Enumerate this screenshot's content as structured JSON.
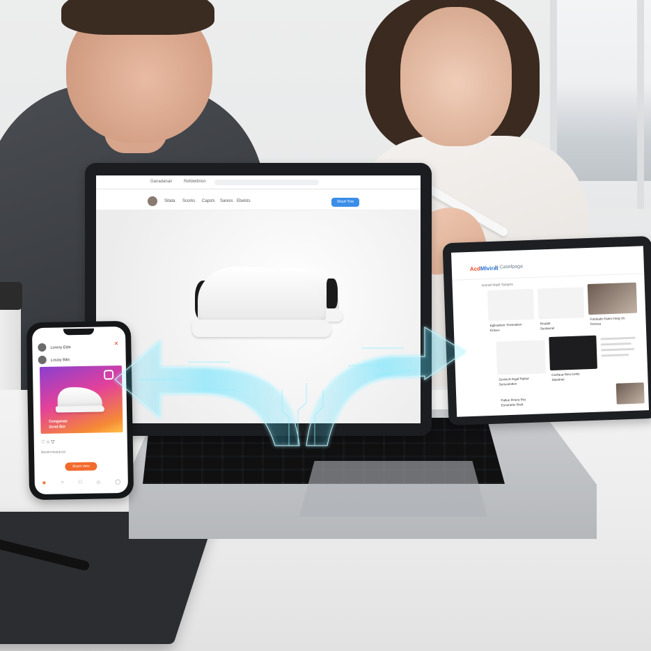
{
  "laptop": {
    "topbar_left": "Ganadanan",
    "topbar_mid": "Refdwtitrion",
    "nav_brand": "Sitata",
    "nav_items": [
      "Scorks",
      "Capsts",
      "Saress",
      "Ebelsts"
    ],
    "cta_label": "Shurt Yne"
  },
  "tablet": {
    "logo_part1": "Acd",
    "logo_part2": "Mlvirat",
    "logo_suffix": "",
    "subtitle": "K Caselpaga",
    "filter": "Arsntd Matlt  Taiopns",
    "cards": [
      {
        "caption": "Egiloartenr Tsrarvation",
        "sub": "Ertoeo"
      },
      {
        "caption": "Rrstabt",
        "sub": "Ssotaonel"
      },
      {
        "caption": "Fardeatis fsaeo irasg cts",
        "sub": "Ferinsa"
      },
      {
        "caption": "Gonsicrt Argal Raltsd",
        "sub": "Sorsuolotton"
      },
      {
        "caption": "Cesfaua Rinu lorrtls",
        "sub": "Stasbnet"
      },
      {
        "caption": "Paltue Rnera Rss",
        "sub": "Solwo Bolrt"
      },
      {
        "caption": "Esrstnetto Rndt",
        "sub": ""
      }
    ]
  },
  "phone": {
    "row1": "Loreny Ettle",
    "row2": "Lossty Bills",
    "post_line1": "Conganas",
    "post_line2": "Grnd Bin",
    "footer_text": "Bestinolsatarias",
    "button": "Sharo Vero"
  },
  "colors": {
    "cta_blue": "#3b8ee8",
    "phone_orange": "#f26a2c",
    "holo_cyan": "#4fe0ff"
  }
}
